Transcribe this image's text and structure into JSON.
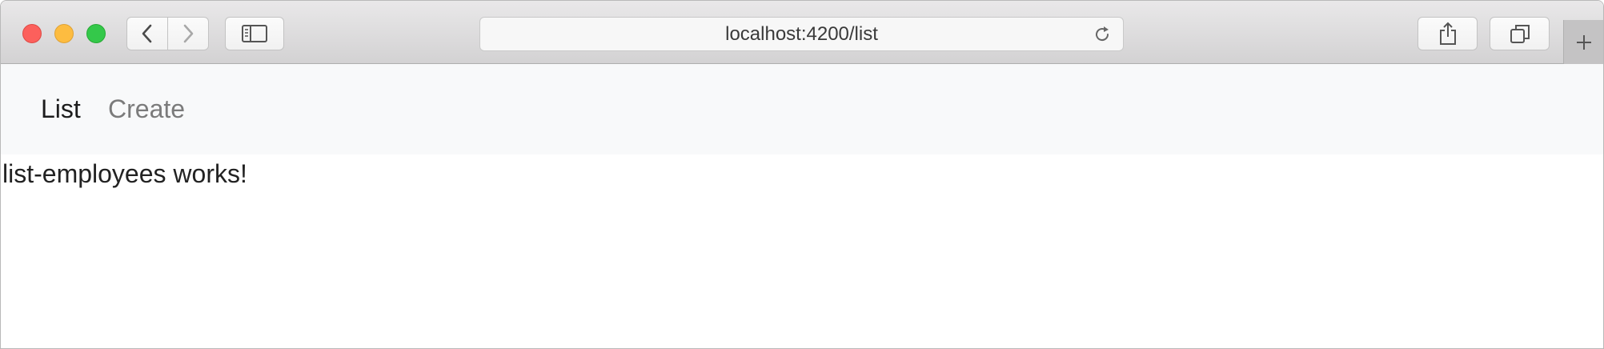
{
  "browser": {
    "url": "localhost:4200/list",
    "icons": {
      "back": "chevron-left-icon",
      "forward": "chevron-right-icon",
      "sidebar": "sidebar-icon",
      "reload": "reload-icon",
      "share": "share-icon",
      "tabs": "tabs-overview-icon",
      "new_tab": "plus-icon"
    }
  },
  "nav": {
    "items": [
      {
        "label": "List",
        "active": true
      },
      {
        "label": "Create",
        "active": false
      }
    ]
  },
  "content": {
    "message": "list-employees works!"
  },
  "colors": {
    "navbar_bg": "#f8f9fa",
    "active_link": "#1d1d1d",
    "inactive_link": "#7b7b7b",
    "close": "#fc605c",
    "minimize": "#fdbc40",
    "maximize": "#34c84a"
  }
}
